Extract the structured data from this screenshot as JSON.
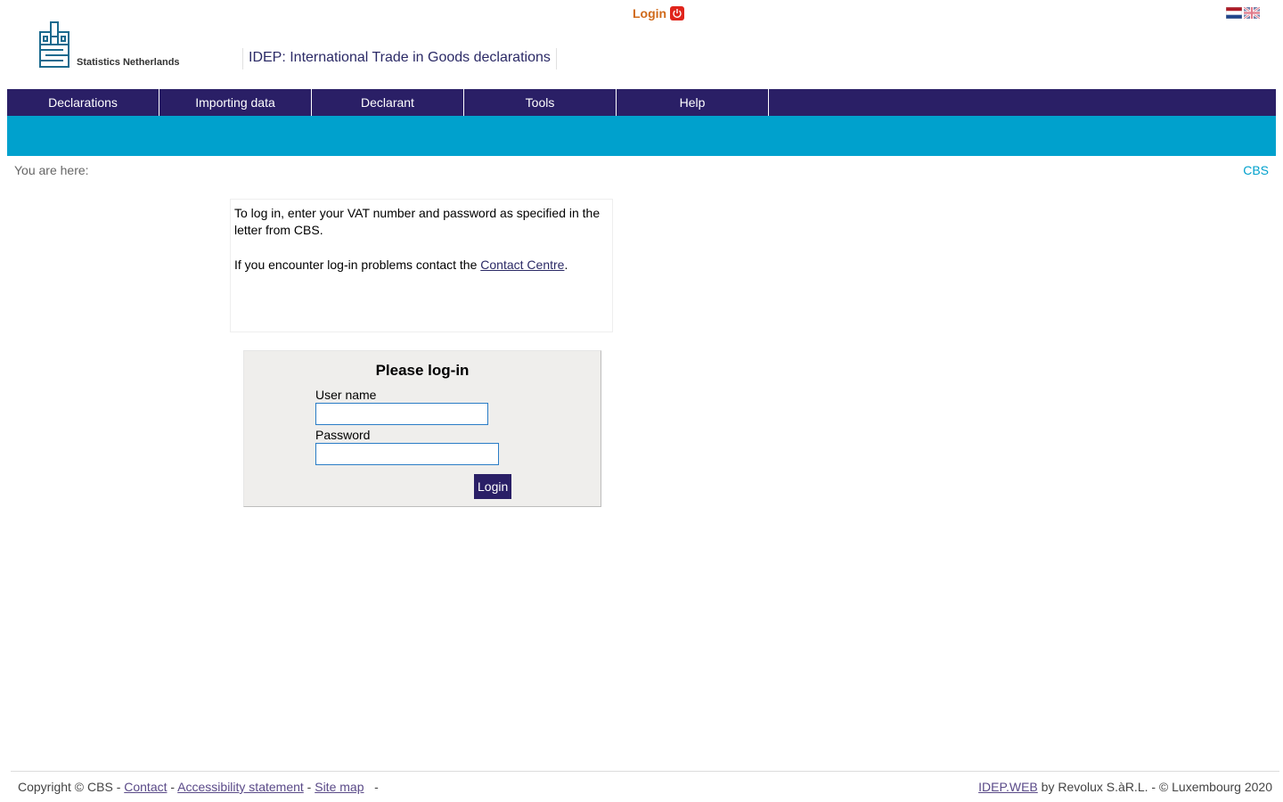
{
  "header": {
    "logo_text": "Statistics Netherlands",
    "app_title": "IDEP: International Trade in Goods declarations",
    "login_link": "Login",
    "brand_color": "#2a1f66",
    "accent_color": "#00a1cd",
    "login_color": "#d06a1a"
  },
  "nav": {
    "items": [
      {
        "label": "Declarations"
      },
      {
        "label": "Importing data"
      },
      {
        "label": "Declarant"
      },
      {
        "label": "Tools"
      },
      {
        "label": "Help"
      }
    ]
  },
  "breadcrumb": {
    "label": "You are here:",
    "site_link": "CBS"
  },
  "info": {
    "line1": "To log in, enter your VAT number and password as specified in the letter from CBS.",
    "line2_prefix": "If you encounter log-in problems contact the ",
    "contact_link": "Contact Centre",
    "line2_suffix": "."
  },
  "login_form": {
    "title": "Please log-in",
    "username_label": "User name",
    "username_value": "",
    "password_label": "Password",
    "password_value": "",
    "submit_label": "Login"
  },
  "footer": {
    "copyright": "Copyright © CBS - ",
    "contact": "Contact",
    "sep": " - ",
    "accessibility": "Accessibility statement",
    "sitemap": "Site map",
    "trailing": "   -",
    "product_link": "IDEP.WEB",
    "credits": " by Revolux S.àR.L. - © Luxembourg 2020"
  },
  "icons": {
    "power": "power-icon",
    "flag_nl": "flag-nl-icon",
    "flag_uk": "flag-uk-icon",
    "logo": "cbs-logo-icon"
  }
}
